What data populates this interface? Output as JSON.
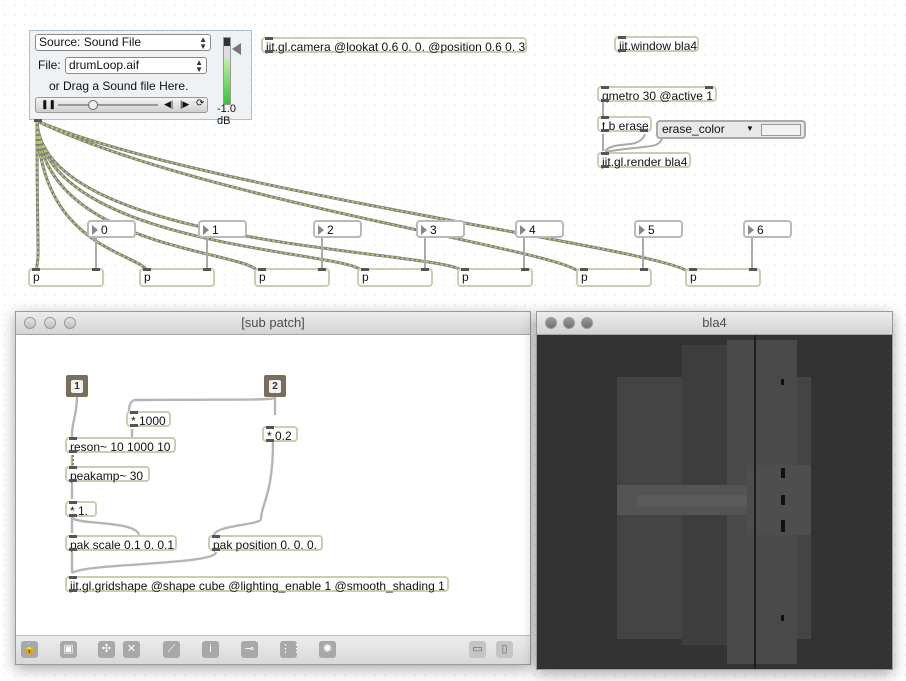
{
  "player": {
    "source_label": "Source: Sound File",
    "file_label": "File:",
    "file_value": "drumLoop.aif",
    "drag_hint": "or Drag a Sound file Here.",
    "level": "-1.0 dB"
  },
  "objects": {
    "camera": "jit.gl.camera @lookat 0.6 0. 0. @position 0.6 0. 3",
    "window": "jit.window bla4",
    "qmetro": "qmetro 30 @active 1",
    "tb": "t b erase",
    "erase_color": "erase_color",
    "render": "jit.gl.render bla4"
  },
  "numbers": [
    "0",
    "1",
    "2",
    "3",
    "4",
    "5",
    "6"
  ],
  "p_objects": [
    "p",
    "p",
    "p",
    "p",
    "p",
    "p",
    "p"
  ],
  "subpatch": {
    "title": "[sub patch]",
    "inlet1": "1",
    "inlet2": "2",
    "mul1000": "* 1000",
    "mul02": "* 0.2",
    "reson": "reson~ 10 1000 10",
    "peakamp": "peakamp~ 30",
    "mul1": "* 1.",
    "pak_scale": "pak scale 0.1 0. 0.1",
    "pak_position": "pak position 0. 0. 0.",
    "gridshape": "jit.gl.gridshape @shape cube @lighting_enable 1 @smooth_shading 1"
  },
  "render_window": {
    "title": "bla4"
  },
  "colors": {
    "object_border": "#c8cfb0",
    "signal_cord": "#9fc047",
    "render_bg": "#343434"
  }
}
